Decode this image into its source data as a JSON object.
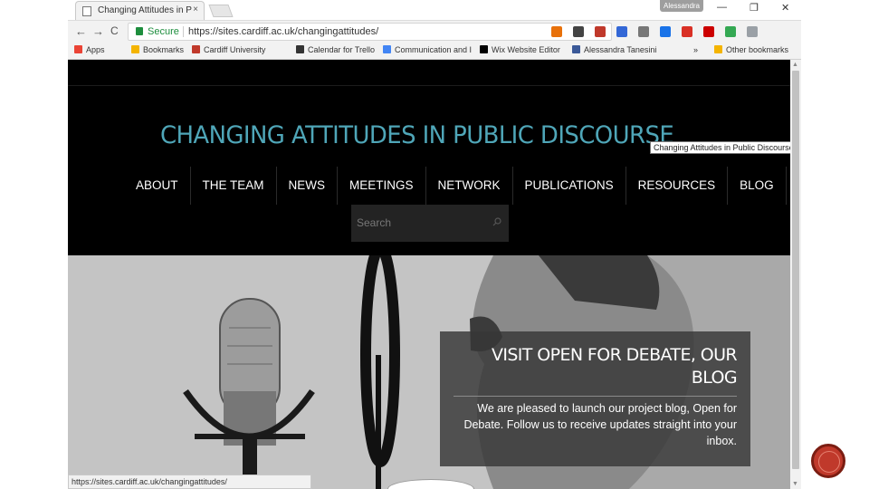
{
  "browser": {
    "tab_title": "Changing Attitudes in Pub",
    "tab_close": "×",
    "profile_name": "Alessandra",
    "window_controls": {
      "minimize": "—",
      "restore": "❐",
      "close": "✕"
    },
    "nav": {
      "back": "←",
      "forward": "→",
      "reload": "C"
    },
    "address": {
      "security_label": "Secure",
      "url": "https://sites.cardiff.ac.uk/changingattitudes/",
      "bookmark_star": "★"
    },
    "bookmarks": [
      {
        "label": "Apps",
        "color": "#ea4335"
      },
      {
        "label": "Bookmarks",
        "color": "#f4b400"
      },
      {
        "label": "Cardiff University",
        "color": "#c0392b"
      },
      {
        "label": "Calendar for Trello",
        "color": "#333333"
      },
      {
        "label": "Communication and I",
        "color": "#4285f4"
      },
      {
        "label": "Wix Website Editor",
        "color": "#000000"
      },
      {
        "label": "Alessandra Tanesini",
        "color": "#3b5998"
      }
    ],
    "bookmarks_overflow": "»",
    "other_bookmarks": "Other bookmarks",
    "extensions": [
      "#e8710a",
      "#444444",
      "#c0392b",
      "#3367d6",
      "#777777",
      "#1a73e8",
      "#d93025",
      "#cc0000",
      "#34a853",
      "#9aa0a6"
    ]
  },
  "site": {
    "title": "CHANGING ATTITUDES IN PUBLIC DISCOURSE",
    "title_tooltip": "Changing Attitudes in Public Discourse",
    "nav_items": [
      "ABOUT",
      "THE TEAM",
      "NEWS",
      "MEETINGS",
      "NETWORK",
      "PUBLICATIONS",
      "RESOURCES",
      "BLOG"
    ],
    "search_placeholder": "Search",
    "hero": {
      "card_title": "VISIT OPEN FOR DEBATE, OUR BLOG",
      "card_body": "We are pleased to launch our project blog, Open for Debate. Follow us to receive updates straight into your inbox."
    },
    "colors": {
      "title": "#4fa6b8",
      "header_bg": "#000000"
    }
  },
  "status_bar": {
    "hover_url": "https://sites.cardiff.ac.uk/changingattitudes/"
  }
}
